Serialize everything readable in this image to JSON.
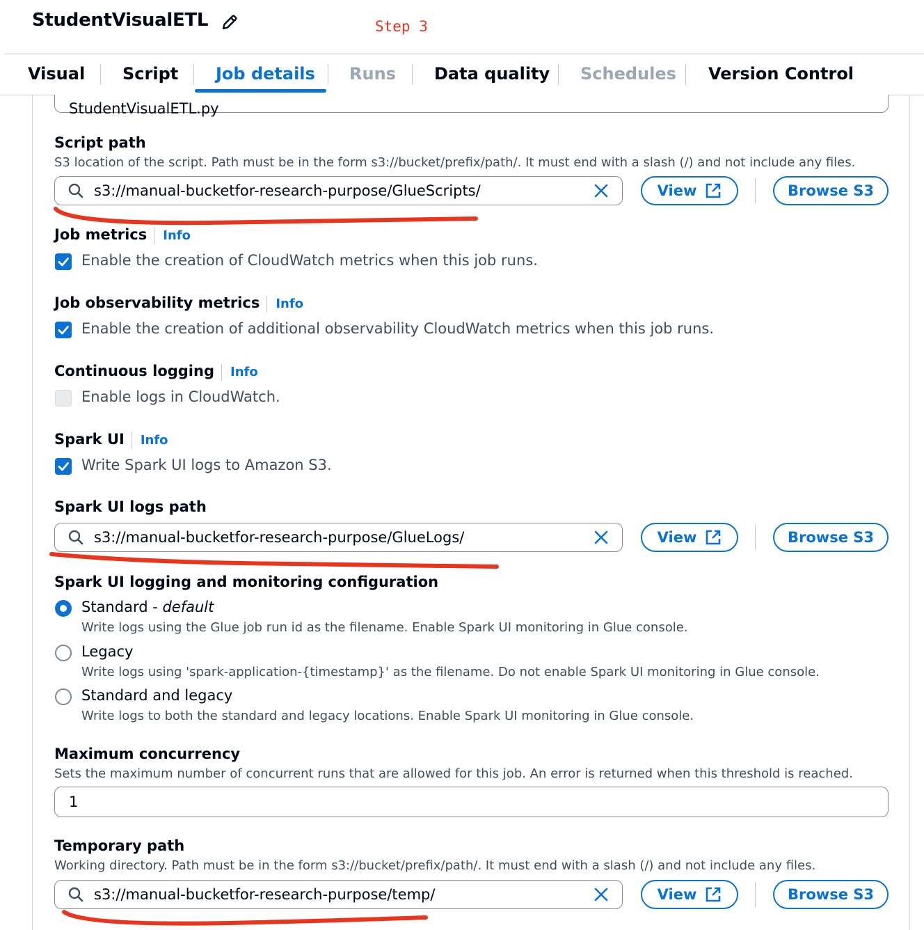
{
  "header": {
    "job_name": "StudentVisualETL",
    "step_note": "Step 3"
  },
  "tabs": [
    {
      "label": "Visual",
      "state": "normal"
    },
    {
      "label": "Script",
      "state": "normal"
    },
    {
      "label": "Job details",
      "state": "active"
    },
    {
      "label": "Runs",
      "state": "disabled"
    },
    {
      "label": "Data quality",
      "state": "normal"
    },
    {
      "label": "Schedules",
      "state": "disabled"
    },
    {
      "label": "Version Control",
      "state": "normal"
    }
  ],
  "script_filename": {
    "value": "StudentVisualETL.py"
  },
  "script_path": {
    "label": "Script path",
    "description": "S3 location of the script. Path must be in the form s3://bucket/prefix/path/. It must end with a slash (/) and not include any files.",
    "value": "s3://manual-bucketfor-research-purpose/GlueScripts/",
    "view_label": "View",
    "browse_label": "Browse S3"
  },
  "job_metrics": {
    "label": "Job metrics",
    "info": "Info",
    "checkbox_label": "Enable the creation of CloudWatch metrics when this job runs.",
    "checked": true
  },
  "observability_metrics": {
    "label": "Job observability metrics",
    "info": "Info",
    "checkbox_label": "Enable the creation of additional observability CloudWatch metrics when this job runs.",
    "checked": true
  },
  "continuous_logging": {
    "label": "Continuous logging",
    "info": "Info",
    "checkbox_label": "Enable logs in CloudWatch.",
    "checked": false
  },
  "spark_ui": {
    "label": "Spark UI",
    "info": "Info",
    "checkbox_label": "Write Spark UI logs to Amazon S3.",
    "checked": true
  },
  "spark_ui_logs_path": {
    "label": "Spark UI logs path",
    "value": "s3://manual-bucketfor-research-purpose/GlueLogs/",
    "view_label": "View",
    "browse_label": "Browse S3"
  },
  "spark_ui_logging": {
    "label": "Spark UI logging and monitoring configuration",
    "options": [
      {
        "label": "Standard - ",
        "label_em": "default",
        "description": "Write logs using the Glue job run id as the filename. Enable Spark UI monitoring in Glue console.",
        "selected": true
      },
      {
        "label": "Legacy",
        "label_em": "",
        "description": "Write logs using 'spark-application-{timestamp}' as the filename. Do not enable Spark UI monitoring in Glue console.",
        "selected": false
      },
      {
        "label": "Standard and legacy",
        "label_em": "",
        "description": "Write logs to both the standard and legacy locations. Enable Spark UI monitoring in Glue console.",
        "selected": false
      }
    ]
  },
  "max_concurrency": {
    "label": "Maximum concurrency",
    "description": "Sets the maximum number of concurrent runs that are allowed for this job. An error is returned when this threshold is reached.",
    "value": "1"
  },
  "temporary_path": {
    "label": "Temporary path",
    "description": "Working directory. Path must be in the form s3://bucket/prefix/path/. It must end with a slash (/) and not include any files.",
    "value": "s3://manual-bucketfor-research-purpose/temp/",
    "view_label": "View",
    "browse_label": "Browse S3"
  },
  "colors": {
    "accent": "#0972d3",
    "annotation": "#e8351d",
    "disabled_tab": "#9ba7b6"
  }
}
